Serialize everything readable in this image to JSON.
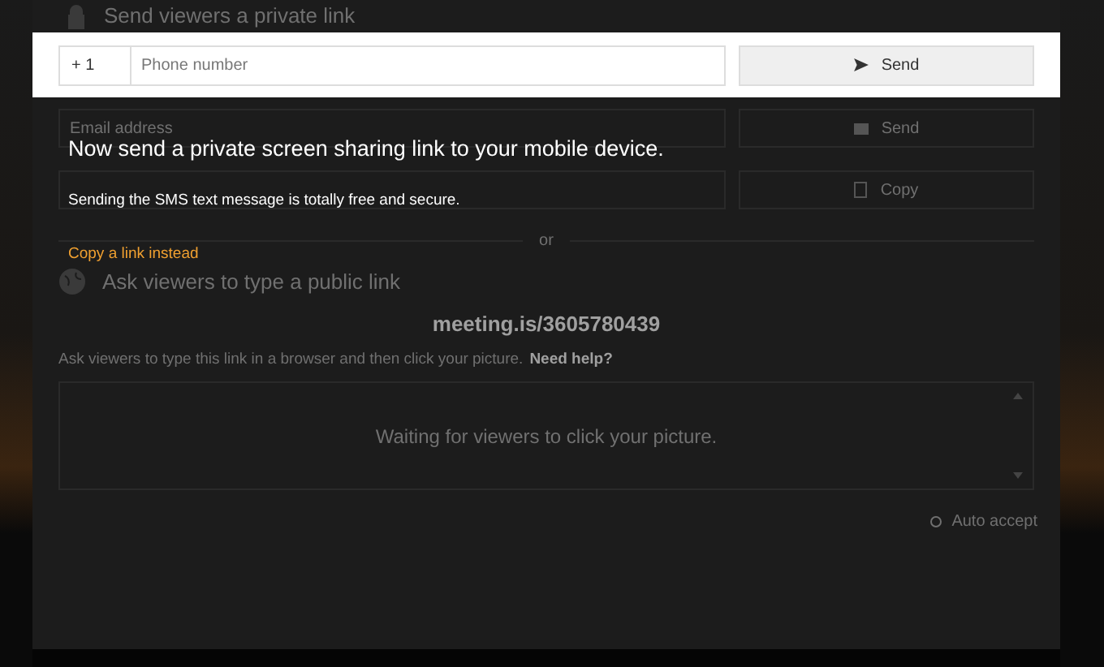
{
  "private_section": {
    "title": "Send viewers a private link"
  },
  "phone": {
    "country_code": "+ 1",
    "placeholder": "Phone number",
    "send_button": "Send"
  },
  "email": {
    "placeholder": "Email address",
    "send_button": "Send"
  },
  "link": {
    "copy_button": "Copy"
  },
  "divider": "or",
  "public_section": {
    "title": "Ask viewers to type a public link",
    "url": "meeting.is/3605780439",
    "instructions": "Ask viewers to type this link in a browser and then click your picture.",
    "help_link": "Need help?",
    "waiting": "Waiting for viewers to click your picture."
  },
  "auto_accept": {
    "label": "Auto accept",
    "checked": false
  },
  "tour": {
    "heading": "Now send a private screen sharing link to your mobile device.",
    "body": "Sending the SMS text message is totally free and secure.",
    "link": "Copy a link instead"
  }
}
